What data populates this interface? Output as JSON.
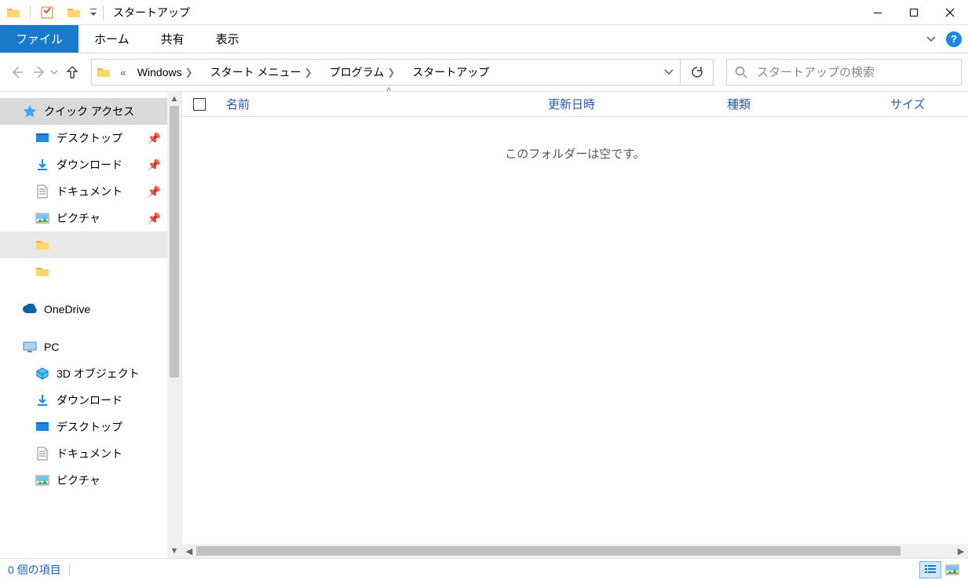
{
  "titlebar": {
    "title": "スタートアップ"
  },
  "ribbon": {
    "file": "ファイル",
    "home": "ホーム",
    "share": "共有",
    "view": "表示"
  },
  "breadcrumb": {
    "items": [
      "Windows",
      "スタート メニュー",
      "プログラム",
      "スタートアップ"
    ]
  },
  "search": {
    "placeholder": "スタートアップの検索"
  },
  "columns": {
    "name": "名前",
    "date": "更新日時",
    "type": "種類",
    "size": "サイズ"
  },
  "content": {
    "empty_message": "このフォルダーは空です。"
  },
  "nav": {
    "quick_access": "クイック アクセス",
    "desktop": "デスクトップ",
    "downloads": "ダウンロード",
    "documents": "ドキュメント",
    "pictures": "ピクチャ",
    "onedrive": "OneDrive",
    "pc": "PC",
    "objects3d": "3D オブジェクト"
  },
  "status": {
    "item_count": "0 個の項目"
  }
}
